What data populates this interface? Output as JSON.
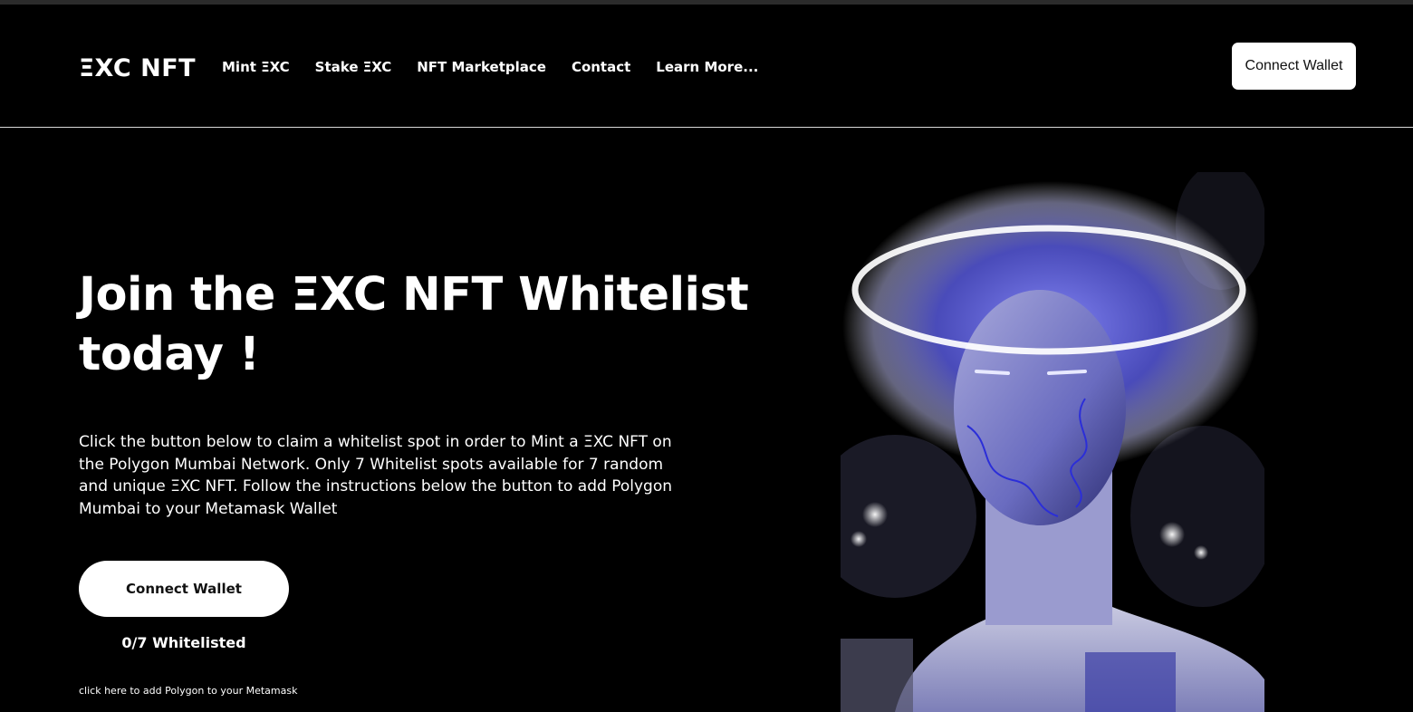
{
  "header": {
    "logo": "ΞXC NFT",
    "nav": [
      {
        "label": "Mint ΞXC"
      },
      {
        "label": "Stake ΞXC"
      },
      {
        "label": "NFT Marketplace"
      },
      {
        "label": "Contact"
      },
      {
        "label": "Learn More..."
      }
    ],
    "connect_label": "Connect Wallet"
  },
  "hero": {
    "title": "Join the ΞXC NFT Whitelist today !",
    "description": "Click the button below to claim a whitelist spot in order to Mint a ΞXC NFT on the Polygon Mumbai Network. Only 7 Whitelist spots available for 7 random and unique ΞXC NFT. Follow the instructions below the button to add Polygon Mumbai to your Metamask Wallet",
    "connect_label": "Connect Wallet",
    "whitelist_count": "0/7 Whitelisted",
    "polygon_link": "click here to add Polygon to your Metamask"
  },
  "colors": {
    "background": "#000000",
    "button_bg": "#ffffff",
    "accent": "#5a5cf0"
  },
  "image": {
    "icon": "nft-artwork-figure-with-halo"
  }
}
